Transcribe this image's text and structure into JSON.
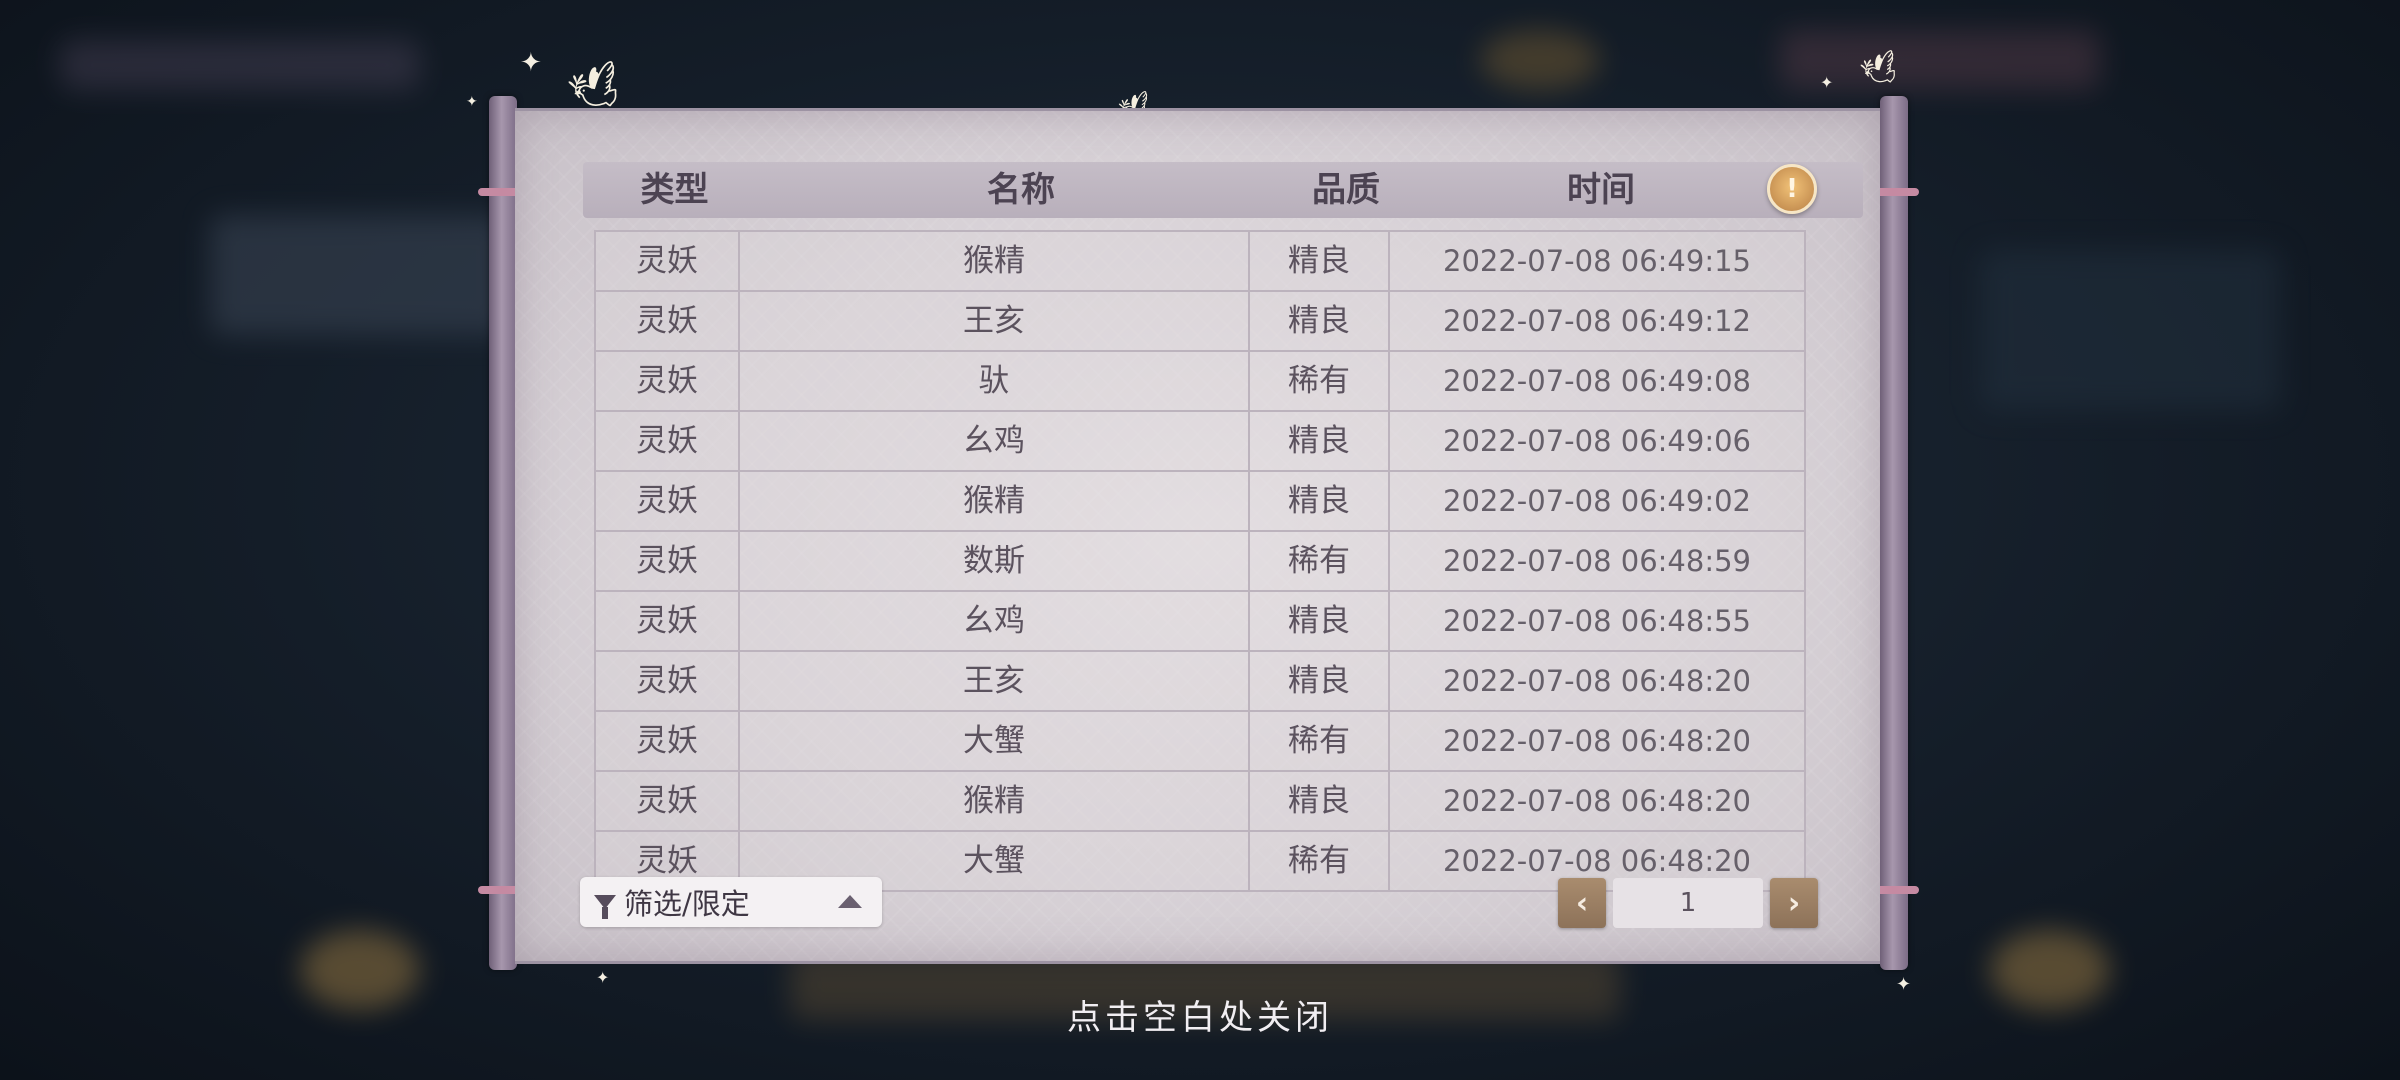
{
  "dialog": {
    "headers": {
      "type": "类型",
      "name": "名称",
      "quality": "品质",
      "time": "时间"
    },
    "info_icon": "info-icon",
    "rows": [
      {
        "type": "灵妖",
        "name": "猴精",
        "quality": "精良",
        "time": "2022-07-08  06:49:15"
      },
      {
        "type": "灵妖",
        "name": "王亥",
        "quality": "精良",
        "time": "2022-07-08  06:49:12"
      },
      {
        "type": "灵妖",
        "name": "驮",
        "quality": "稀有",
        "time": "2022-07-08  06:49:08"
      },
      {
        "type": "灵妖",
        "name": "幺鸡",
        "quality": "精良",
        "time": "2022-07-08  06:49:06"
      },
      {
        "type": "灵妖",
        "name": "猴精",
        "quality": "精良",
        "time": "2022-07-08  06:49:02"
      },
      {
        "type": "灵妖",
        "name": "数斯",
        "quality": "稀有",
        "time": "2022-07-08  06:48:59"
      },
      {
        "type": "灵妖",
        "name": "幺鸡",
        "quality": "精良",
        "time": "2022-07-08  06:48:55"
      },
      {
        "type": "灵妖",
        "name": "王亥",
        "quality": "精良",
        "time": "2022-07-08  06:48:20"
      },
      {
        "type": "灵妖",
        "name": "大蟹",
        "quality": "稀有",
        "time": "2022-07-08  06:48:20"
      },
      {
        "type": "灵妖",
        "name": "猴精",
        "quality": "精良",
        "time": "2022-07-08  06:48:20"
      },
      {
        "type": "灵妖",
        "name": "大蟹",
        "quality": "稀有",
        "time": "2022-07-08  06:48:20"
      }
    ],
    "filter": {
      "label": "筛选/限定",
      "icon": "filter-icon",
      "arrow_icon": "caret-up-icon"
    },
    "pagination": {
      "current_page": "1",
      "prev_icon": "chevron-left-icon",
      "next_icon": "chevron-right-icon"
    }
  },
  "close_hint": "点击空白处关闭",
  "colors": {
    "paper": "#ddd7dc",
    "rod": "#8f7f98",
    "accent_button": "#9a7e63",
    "info_button": "#d9a45f"
  }
}
